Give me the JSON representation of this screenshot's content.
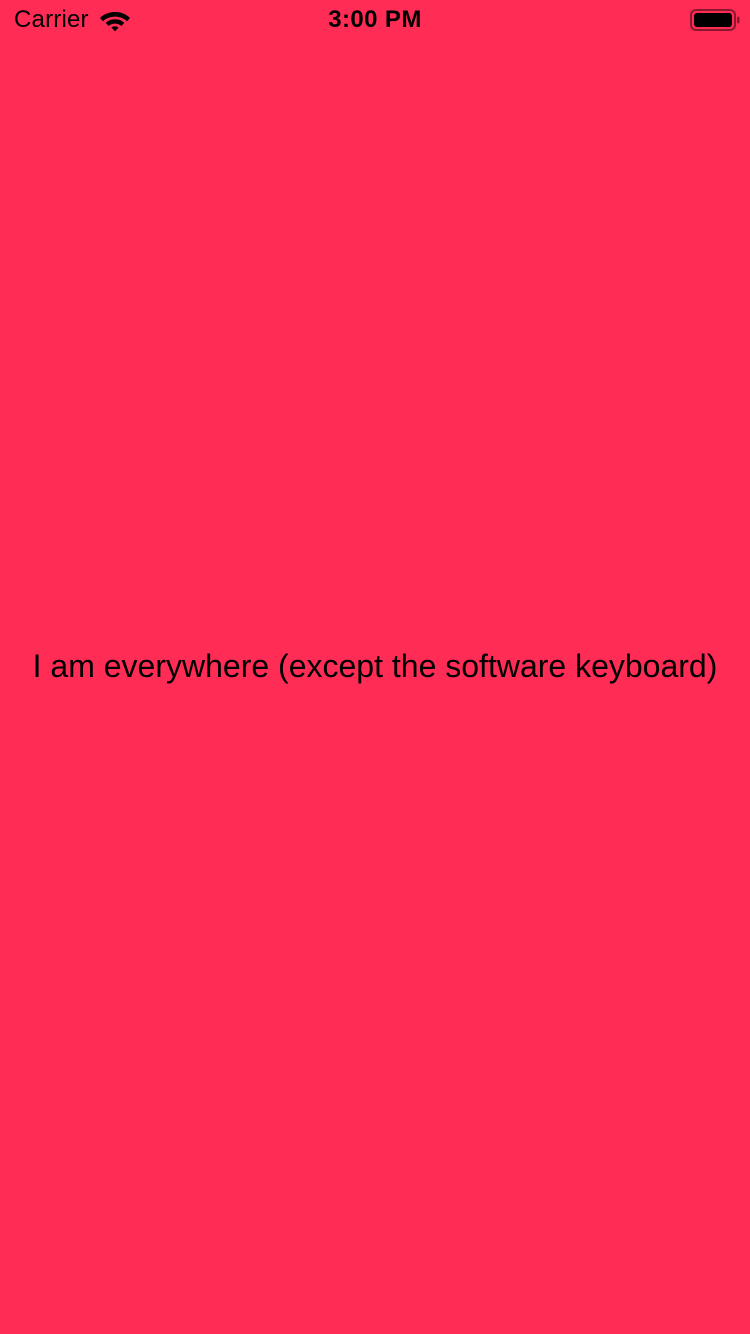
{
  "status_bar": {
    "carrier": "Carrier",
    "time": "3:00 PM",
    "wifi_icon": "wifi-icon",
    "battery_icon": "battery-icon"
  },
  "main": {
    "message": "I am everywhere (except the software keyboard)"
  },
  "colors": {
    "background": "#FF2D55",
    "text": "#000000"
  }
}
